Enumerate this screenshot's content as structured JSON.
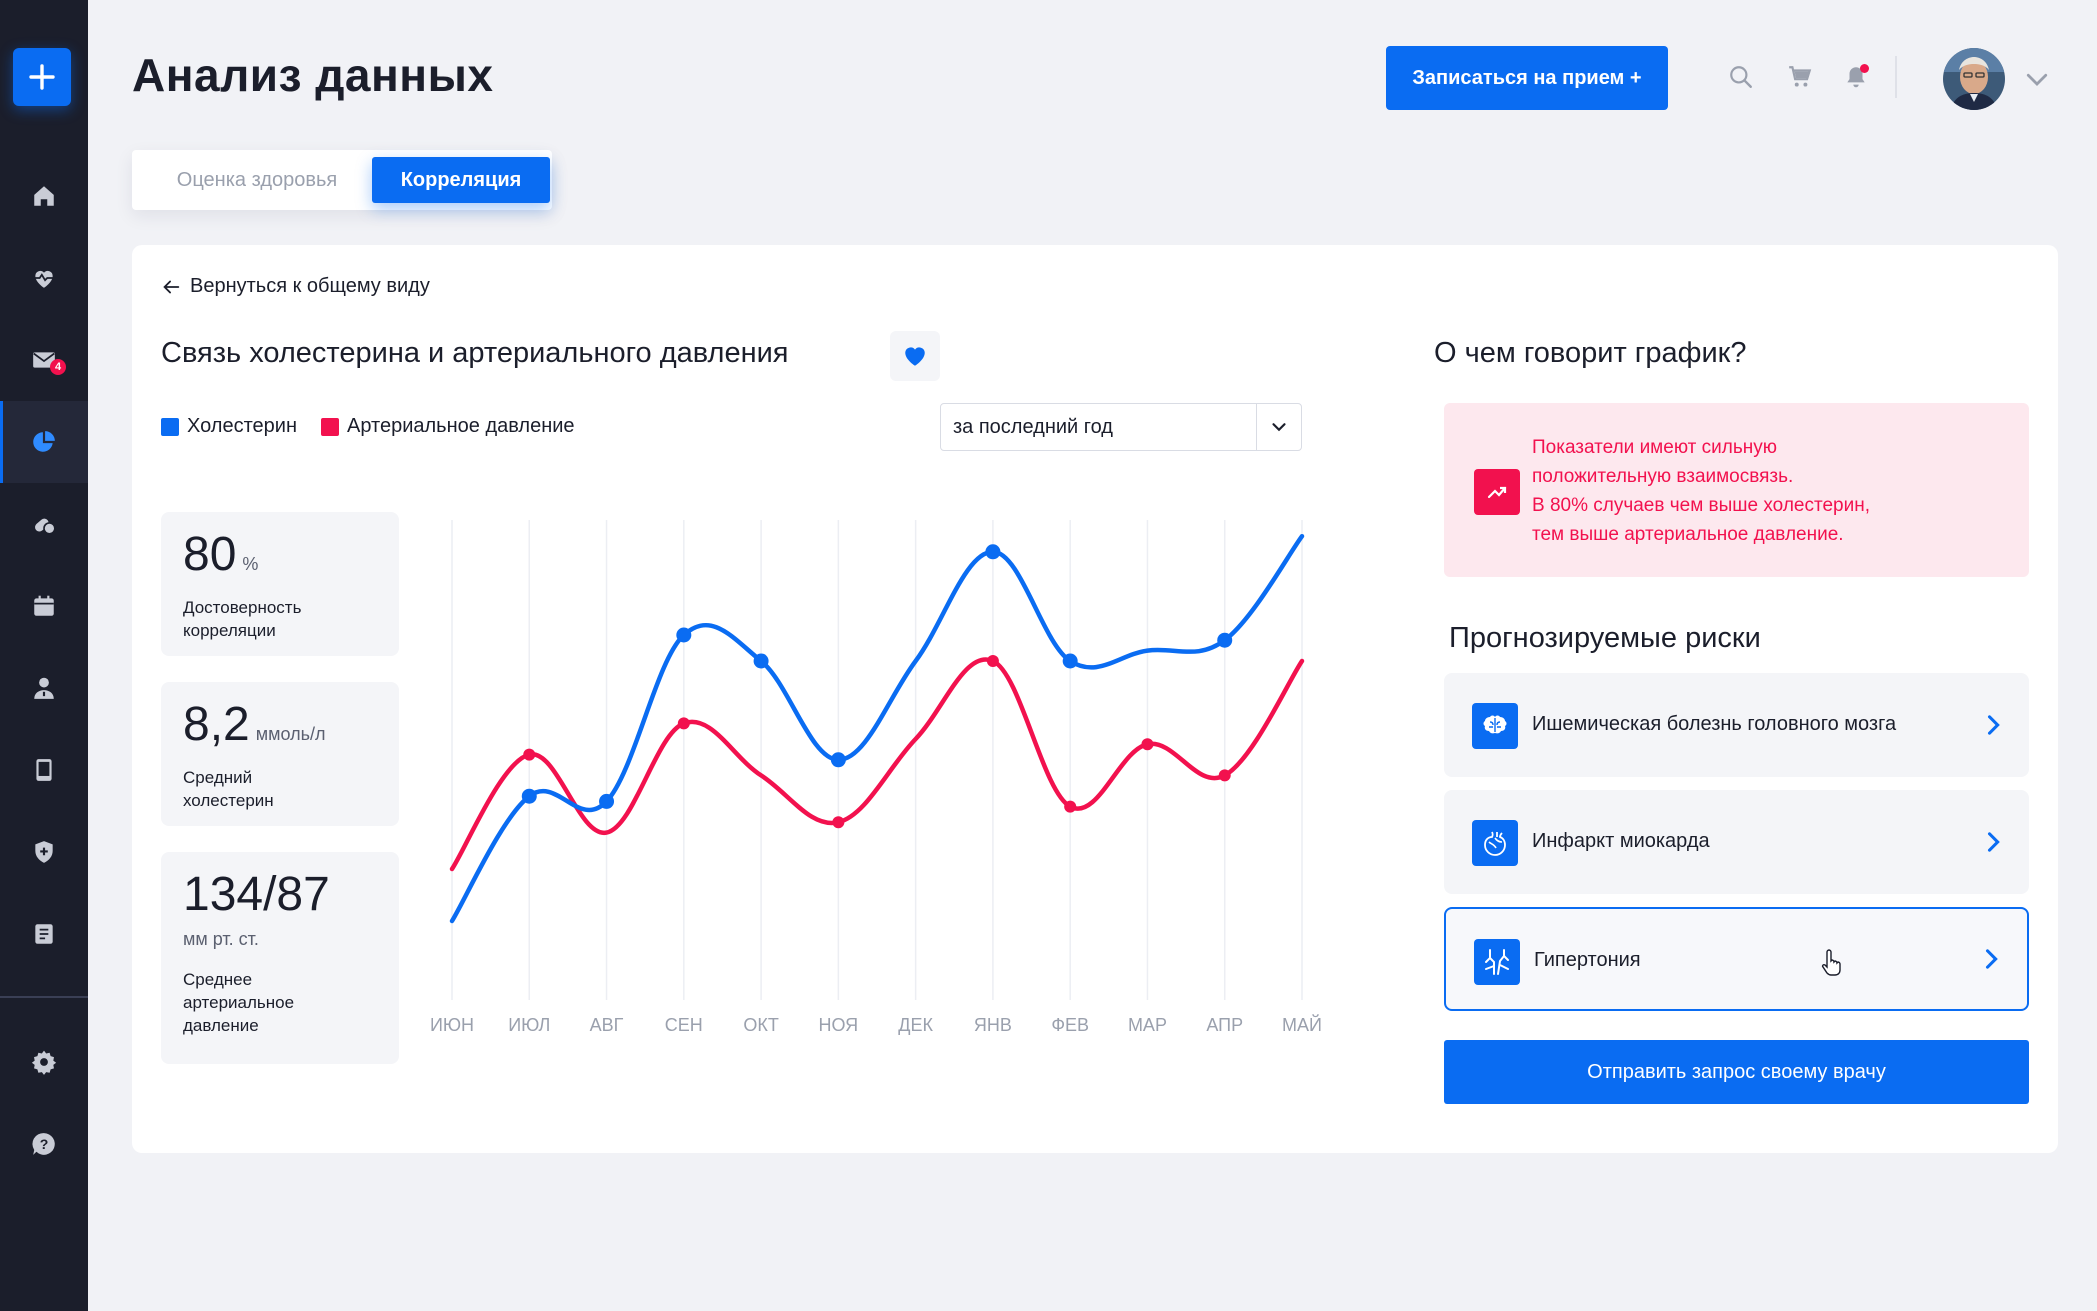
{
  "app": {
    "title": "Анализ данных",
    "appointment_button": "Записаться на прием +"
  },
  "sidebar": {
    "items": [
      {
        "icon": "home-icon"
      },
      {
        "icon": "heart-pulse-icon"
      },
      {
        "icon": "mail-icon",
        "badge": "4"
      },
      {
        "icon": "pie-chart-icon",
        "active": true
      },
      {
        "icon": "pills-icon"
      },
      {
        "icon": "calendar-icon"
      },
      {
        "icon": "doctor-icon"
      },
      {
        "icon": "tablet-icon"
      },
      {
        "icon": "shield-plus-icon"
      },
      {
        "icon": "book-icon"
      },
      {
        "icon": "gear-icon"
      },
      {
        "icon": "help-icon"
      }
    ]
  },
  "tabs": [
    {
      "label": "Оценка здоровья"
    },
    {
      "label": "Корреляция",
      "active": true
    }
  ],
  "card": {
    "back_link": "Вернуться к общему виду",
    "chart_title": "Связь холестерина и артериального давления",
    "period": "за последний год",
    "stats": [
      {
        "value": "80",
        "unit": "%",
        "label_line1": "Достоверность",
        "label_line2": "корреляции"
      },
      {
        "value": "8,2",
        "unit": "ммоль/л",
        "label_line1": "Средний",
        "label_line2": "холестерин"
      },
      {
        "value": "134/87",
        "unit": "мм рт. ст.",
        "label_line1": "Среднее",
        "label_line2": "артериальное",
        "label_line3": "давление"
      }
    ]
  },
  "colors": {
    "accent": "#0a6cf2",
    "danger": "#f2114e",
    "sidebar": "#1b1e2b"
  },
  "chart_data": {
    "type": "line",
    "categories": [
      "ИЮН",
      "ИЮЛ",
      "АВГ",
      "СЕН",
      "ОКТ",
      "НОЯ",
      "ДЕК",
      "ЯНВ",
      "ФЕВ",
      "МАР",
      "АПР",
      "МАЙ"
    ],
    "series": [
      {
        "name": "Холестерин",
        "color": "#0a6cf2",
        "values": [
          20,
          44,
          43,
          75,
          70,
          51,
          70,
          91,
          70,
          72,
          74,
          94
        ],
        "markers": [
          false,
          true,
          true,
          true,
          true,
          true,
          false,
          true,
          true,
          false,
          true,
          false
        ]
      },
      {
        "name": "Артериальное давление",
        "color": "#f2114e",
        "values": [
          30,
          52,
          37,
          58,
          48,
          39,
          55,
          70,
          42,
          54,
          48,
          70
        ],
        "markers": [
          false,
          true,
          false,
          true,
          false,
          true,
          false,
          true,
          true,
          true,
          true,
          false
        ]
      }
    ],
    "ylim": [
      0,
      100
    ],
    "grid": "vertical",
    "legend": "top-left"
  },
  "insight": {
    "line1": "Показатели имеют сильную",
    "line2": "положительную взаимосвязь.",
    "line3": "В 80% случаев чем выше холестерин,",
    "line4": "тем выше артериальное давление."
  },
  "risks": {
    "title": "Прогнозируемые риски",
    "question": "О чем говорит график?",
    "items": [
      {
        "label": "Ишемическая болезнь головного мозга",
        "icon": "brain-icon"
      },
      {
        "label": "Инфаркт миокарда",
        "icon": "heart-organ-icon"
      },
      {
        "label": "Гипертония",
        "icon": "vessels-icon",
        "selected": true
      }
    ],
    "send_button": "Отправить запрос своему врачу"
  }
}
